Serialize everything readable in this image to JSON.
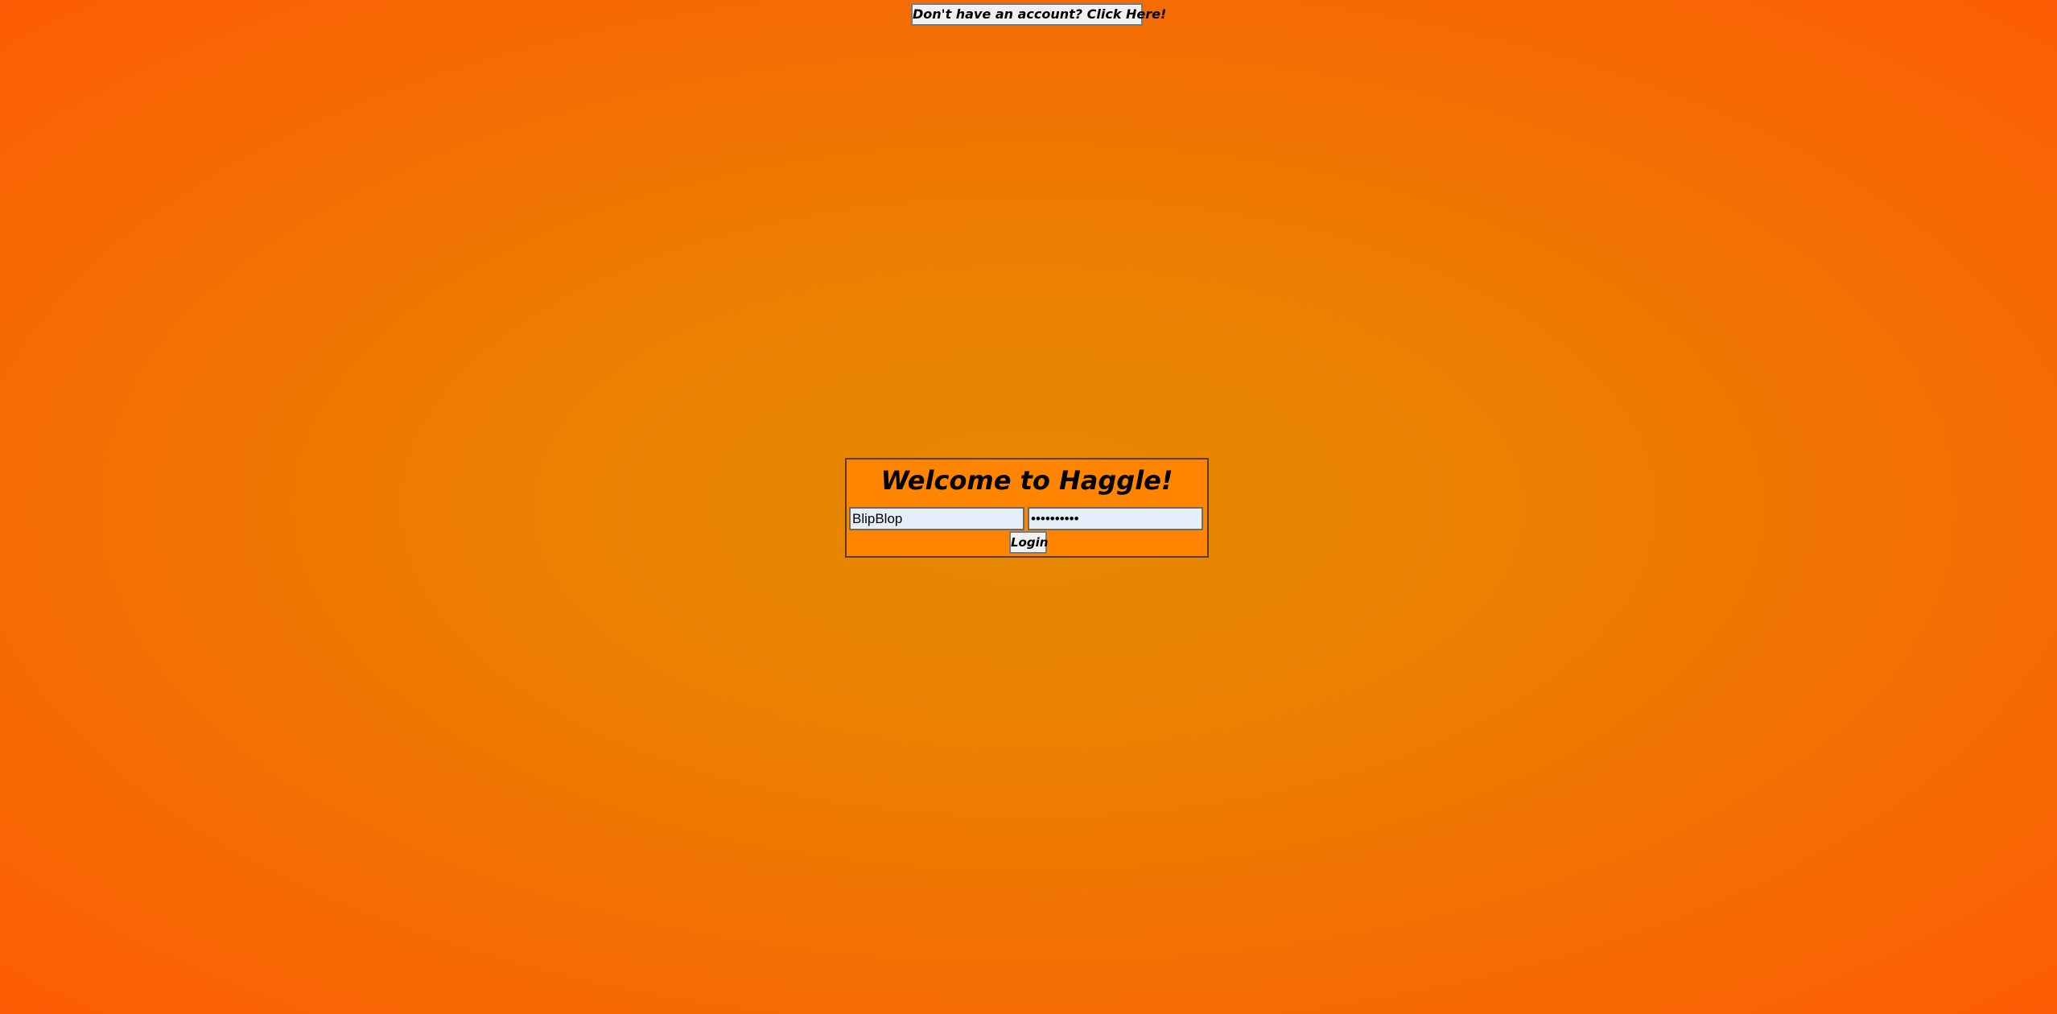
{
  "header": {
    "signup_label": "Don't have an account? Click Here!"
  },
  "login": {
    "title": "Welcome to Haggle!",
    "username_value": "BlipBlop",
    "password_value": "••••••••••",
    "login_label": "Login"
  },
  "colors": {
    "background_center": "#e58a03",
    "background_edge": "#fe5c04",
    "panel": "#ff8400",
    "input_background": "#e6eef9"
  }
}
